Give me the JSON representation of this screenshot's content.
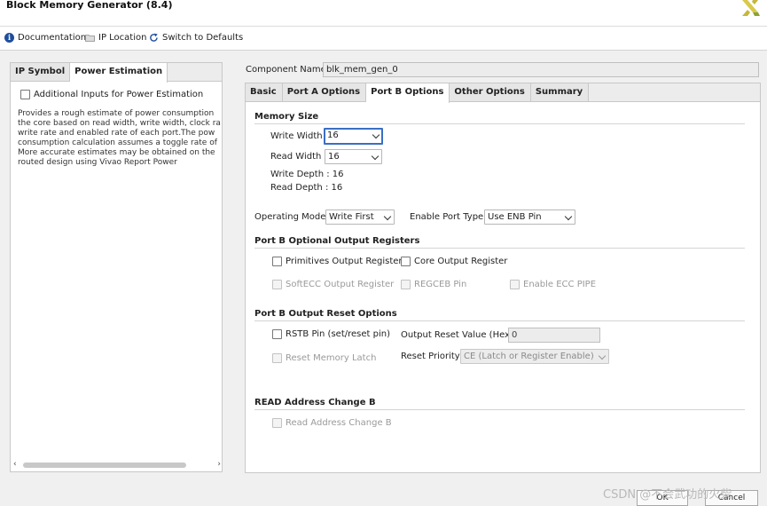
{
  "window": {
    "title": "Block Memory Generator (8.4)",
    "logo_icon": "xilinx-logo-icon"
  },
  "toolbar": {
    "documentation": "Documentation",
    "ip_location": "IP Location",
    "switch_defaults": "Switch to Defaults"
  },
  "left_panel": {
    "tabs": [
      "IP Symbol",
      "Power Estimation"
    ],
    "active_tab": "Power Estimation",
    "additional_inputs_label": "Additional Inputs for Power Estimation",
    "description": [
      "Provides a rough estimate of power consumption",
      "the core based on read width, write width, clock ra",
      "write rate and enabled rate of each port.The pow",
      "consumption calculation assumes a toggle rate of",
      "More accurate estimates may be obtained on the",
      "routed design using Vivao Report Power"
    ]
  },
  "component": {
    "label": "Component Name",
    "value": "blk_mem_gen_0"
  },
  "tabs": [
    "Basic",
    "Port A Options",
    "Port B Options",
    "Other Options",
    "Summary"
  ],
  "active_tab": "Port B Options",
  "memory_size": {
    "title": "Memory Size",
    "write_width_label": "Write Width",
    "write_width_value": "16",
    "read_width_label": "Read Width",
    "read_width_value": "16",
    "write_depth": "Write Depth : 16",
    "read_depth": "Read Depth : 16"
  },
  "operating": {
    "mode_label": "Operating Mode",
    "mode_value": "Write First",
    "enable_label": "Enable Port Type",
    "enable_value": "Use ENB Pin"
  },
  "output_registers": {
    "title": "Port B Optional Output Registers",
    "primitives": "Primitives Output Register",
    "core": "Core Output Register",
    "softecc": "SoftECC Output Register",
    "regceb": "REGCEB Pin",
    "ecc_pipe": "Enable ECC PIPE"
  },
  "reset_options": {
    "title": "Port B Output Reset Options",
    "rstb": "RSTB Pin (set/reset pin)",
    "reset_value_label": "Output Reset Value (Hex)",
    "reset_value": "0",
    "reset_latch": "Reset Memory Latch",
    "priority_label": "Reset Priority",
    "priority_value": "CE (Latch or Register Enable)"
  },
  "read_address": {
    "title": "READ Address Change B",
    "option": "Read Address Change B"
  },
  "buttons": {
    "ok": "OK",
    "cancel": "Cancel"
  },
  "watermark": "CSDN @不会武功的火柴"
}
